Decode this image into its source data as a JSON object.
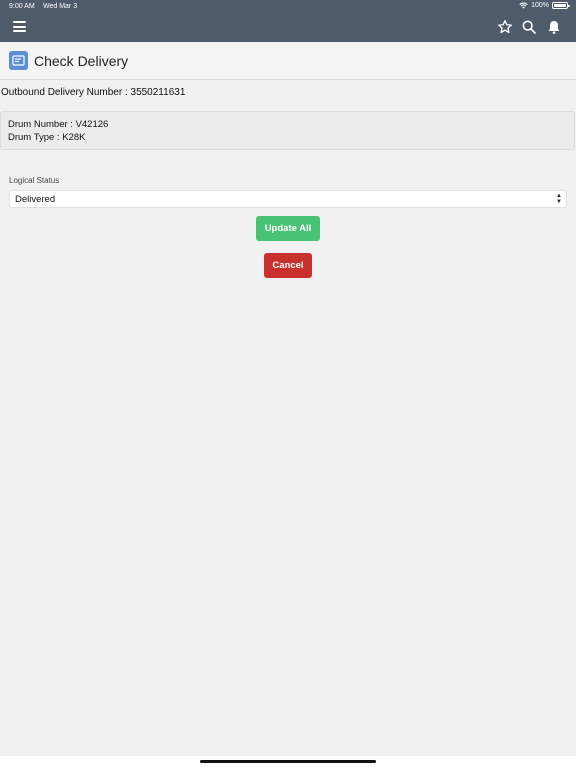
{
  "status_bar": {
    "time": "9:00 AM",
    "date": "Wed Mar 3",
    "battery": "100%"
  },
  "nav": {
    "icons": [
      "menu-icon",
      "star-icon",
      "search-icon",
      "bell-icon"
    ],
    "bg_color": "#4f5b6a"
  },
  "header": {
    "title": "Check Delivery",
    "icon_color": "#5a8fd6"
  },
  "delivery": {
    "outbound_label": "Outbound Delivery Number : 3550211631"
  },
  "drum": {
    "number_line": "Drum Number : V42126",
    "type_line": "Drum Type : K28K"
  },
  "form": {
    "logical_status_label": "Logical Status",
    "logical_status_value": "Delivered"
  },
  "buttons": {
    "update_all": "Update All",
    "cancel": "Cancel",
    "update_color": "#48c274",
    "cancel_color": "#c9302c"
  }
}
